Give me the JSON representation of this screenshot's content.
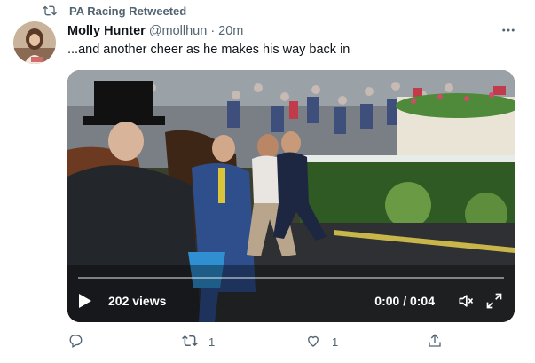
{
  "retweet_banner": {
    "icon": "retweet-icon",
    "text": "PA Racing Retweeted"
  },
  "author": {
    "name": "Molly Hunter",
    "handle": "@mollhun",
    "separator": "·",
    "time": "20m"
  },
  "more_icon": "more-icon",
  "tweet": {
    "text": "...and another cheer as he makes his way back in"
  },
  "video": {
    "views": "202 views",
    "timecode": "0:00 / 0:04",
    "progress": 0,
    "icons": {
      "play": "play-icon",
      "volume": "volume-muted-icon",
      "fullscreen": "fullscreen-icon"
    }
  },
  "actions": {
    "reply": {
      "icon": "reply-icon",
      "count": ""
    },
    "retweet": {
      "icon": "retweet-icon",
      "count": "1"
    },
    "like": {
      "icon": "like-icon",
      "count": "1"
    },
    "share": {
      "icon": "share-icon",
      "count": ""
    }
  },
  "colors": {
    "secondary_text": "#536471",
    "primary_text": "#0f1419",
    "background": "#ffffff"
  }
}
